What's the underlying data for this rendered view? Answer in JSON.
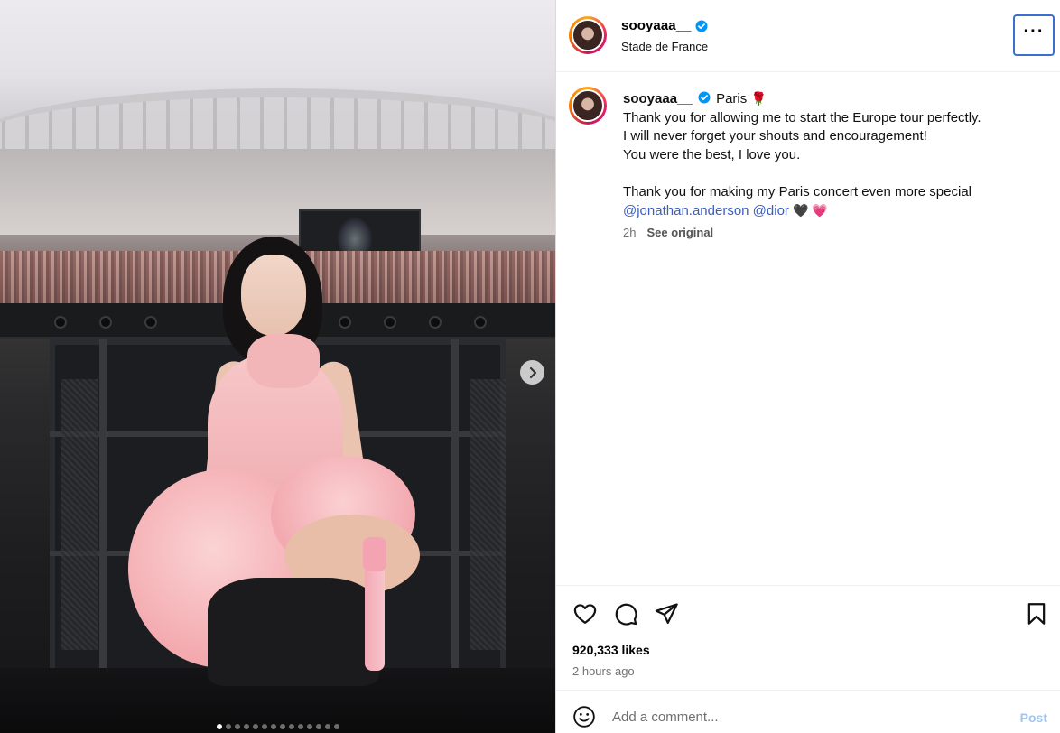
{
  "post": {
    "username": "sooyaaa__",
    "location": "Stade de France",
    "verified": true,
    "more_label": "···"
  },
  "caption": {
    "username": "sooyaaa__",
    "place": "Paris",
    "place_emoji": "🌹",
    "lines": [
      "Thank you for allowing me to start the Europe tour perfectly.",
      "I will never forget your shouts and encouragement!",
      "You were the best, I love you."
    ],
    "line4": "Thank you for making my Paris concert even more special",
    "mentions": [
      "@jonathan.anderson",
      "@dior"
    ],
    "end_emojis": "🖤 💗",
    "timestamp": "2h",
    "see_original": "See original"
  },
  "media": {
    "slide_count": 14,
    "active_slide": 1
  },
  "actions": {
    "likes": "920,333 likes",
    "posted_ago": "2 hours ago"
  },
  "comment": {
    "placeholder": "Add a comment...",
    "post_label": "Post"
  },
  "colors": {
    "mention": "#3b5dbd",
    "post_button_disabled": "#9cc7f4",
    "verified": "#0095f6",
    "focus_ring": "#3b6ecf"
  }
}
